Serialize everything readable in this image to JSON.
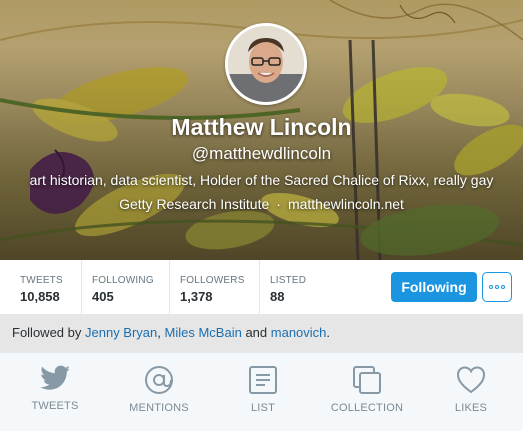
{
  "profile": {
    "display_name": "Matthew Lincoln",
    "handle": "@matthewdlincoln",
    "bio": "art historian, data scientist, Holder of the Sacred Chalice of Rixx, really gay",
    "location": "Getty Research Institute",
    "separator": "·",
    "website": "matthewlincoln.net"
  },
  "stats": [
    {
      "label": "TWEETS",
      "value": "10,858"
    },
    {
      "label": "FOLLOWING",
      "value": "405"
    },
    {
      "label": "FOLLOWERS",
      "value": "1,378"
    },
    {
      "label": "LISTED",
      "value": "88"
    }
  ],
  "actions": {
    "follow_label": "Following",
    "follow_color": "#1b95e0",
    "more_icon": "more-dots-icon"
  },
  "followed_by": {
    "prefix": "Followed by",
    "users": [
      "Jenny Bryan",
      "Miles McBain",
      "manovich"
    ],
    "comma": ",",
    "and": "and",
    "suffix": "."
  },
  "tabs": [
    {
      "label": "TWEETS",
      "icon": "bird-icon"
    },
    {
      "label": "MENTIONS",
      "icon": "at-icon"
    },
    {
      "label": "LIST",
      "icon": "list-icon"
    },
    {
      "label": "COLLECTION",
      "icon": "collection-icon"
    },
    {
      "label": "LIKES",
      "icon": "heart-icon"
    }
  ]
}
